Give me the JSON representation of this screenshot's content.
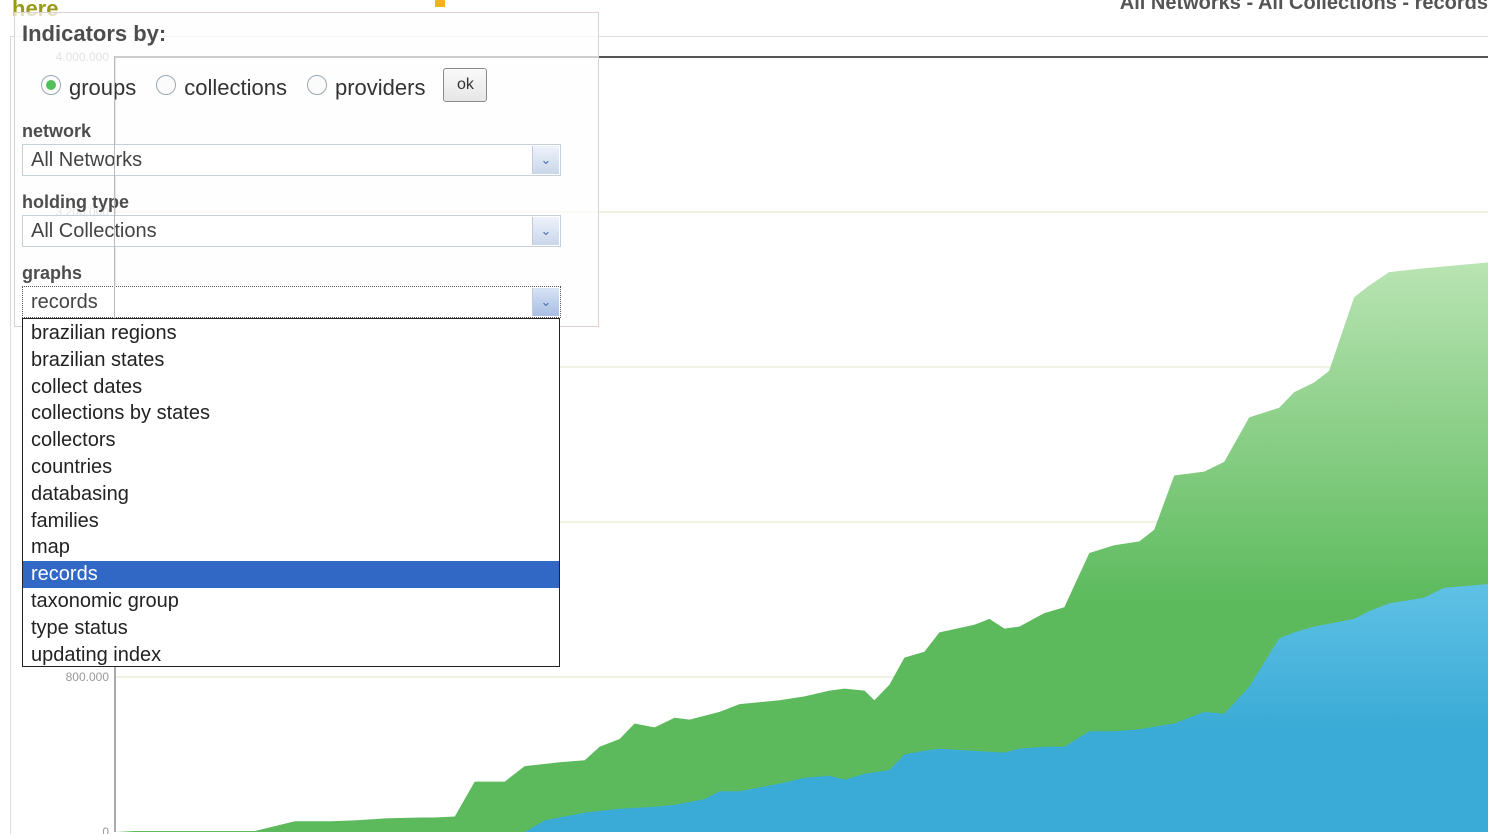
{
  "header": {
    "link_text": "here",
    "title": "All Networks - All Collections - records"
  },
  "panel": {
    "title": "Indicators by:",
    "radios": [
      {
        "label": "groups",
        "checked": true
      },
      {
        "label": "collections",
        "checked": false
      },
      {
        "label": "providers",
        "checked": false
      }
    ],
    "ok_label": "ok",
    "network": {
      "label": "network",
      "value": "All Networks"
    },
    "holding_type": {
      "label": "holding type",
      "value": "All Collections"
    },
    "graphs": {
      "label": "graphs",
      "value": "records"
    }
  },
  "dropdown": {
    "options": [
      "brazilian regions",
      "brazilian states",
      "collect dates",
      "collections by states",
      "collectors",
      "countries",
      "databasing",
      "families",
      "map",
      "records",
      "taxonomic group",
      "type status",
      "updating index"
    ],
    "selected": "records"
  },
  "chart_data": {
    "type": "area",
    "y_tick_labels": [
      "4.000.000",
      "3.200.000",
      "800.000",
      "0"
    ],
    "y_ticks": [
      0,
      800000,
      1600000,
      2400000,
      3200000,
      4000000
    ],
    "ylim": [
      0,
      4000000
    ],
    "grid": true,
    "series": [
      {
        "color": "#5cba5c",
        "fill_top": "#b9e4b3",
        "values": [
          0,
          5000,
          5000,
          5000,
          5000,
          55000,
          55000,
          60000,
          70000,
          75000,
          75000,
          80000,
          260000,
          260000,
          340000,
          360000,
          370000,
          440000,
          480000,
          560000,
          540000,
          590000,
          580000,
          620000,
          660000,
          680000,
          700000,
          730000,
          740000,
          730000,
          680000,
          760000,
          900000,
          930000,
          1030000,
          1070000,
          1100000,
          1050000,
          1060000,
          1130000,
          1160000,
          1440000,
          1480000,
          1500000,
          1560000,
          1840000,
          1860000,
          1910000,
          2140000,
          2190000,
          2270000,
          2320000,
          2380000,
          2760000,
          2820000,
          2890000,
          2910000,
          2940000
        ],
        "x": [
          0,
          20,
          80,
          130,
          140,
          180,
          215,
          240,
          270,
          305,
          320,
          340,
          360,
          390,
          410,
          445,
          470,
          485,
          505,
          520,
          540,
          560,
          575,
          605,
          625,
          665,
          690,
          715,
          730,
          750,
          760,
          775,
          790,
          810,
          825,
          860,
          875,
          890,
          905,
          930,
          950,
          975,
          1000,
          1025,
          1040,
          1060,
          1090,
          1110,
          1135,
          1165,
          1180,
          1200,
          1215,
          1240,
          1255,
          1275,
          1310,
          1375
        ]
      },
      {
        "color": "#3aabd6",
        "fill_top": "#62c2e6",
        "values": [
          0,
          0,
          0,
          0,
          0,
          0,
          0,
          60000,
          100000,
          120000,
          130000,
          140000,
          170000,
          210000,
          210000,
          250000,
          280000,
          290000,
          270000,
          300000,
          320000,
          400000,
          420000,
          430000,
          410000,
          430000,
          440000,
          440000,
          520000,
          520000,
          530000,
          560000,
          620000,
          610000,
          750000,
          1000000,
          1030000,
          1060000,
          1100000,
          1140000,
          1180000,
          1210000,
          1260000,
          1280000,
          1320000,
          1320000
        ],
        "x": [
          0,
          20,
          80,
          140,
          240,
          340,
          410,
          430,
          470,
          505,
          540,
          560,
          590,
          605,
          625,
          665,
          690,
          715,
          730,
          750,
          775,
          790,
          810,
          825,
          890,
          905,
          930,
          950,
          975,
          1000,
          1025,
          1060,
          1090,
          1110,
          1135,
          1165,
          1180,
          1200,
          1240,
          1255,
          1275,
          1310,
          1330,
          1375,
          1390,
          1375
        ]
      }
    ]
  }
}
